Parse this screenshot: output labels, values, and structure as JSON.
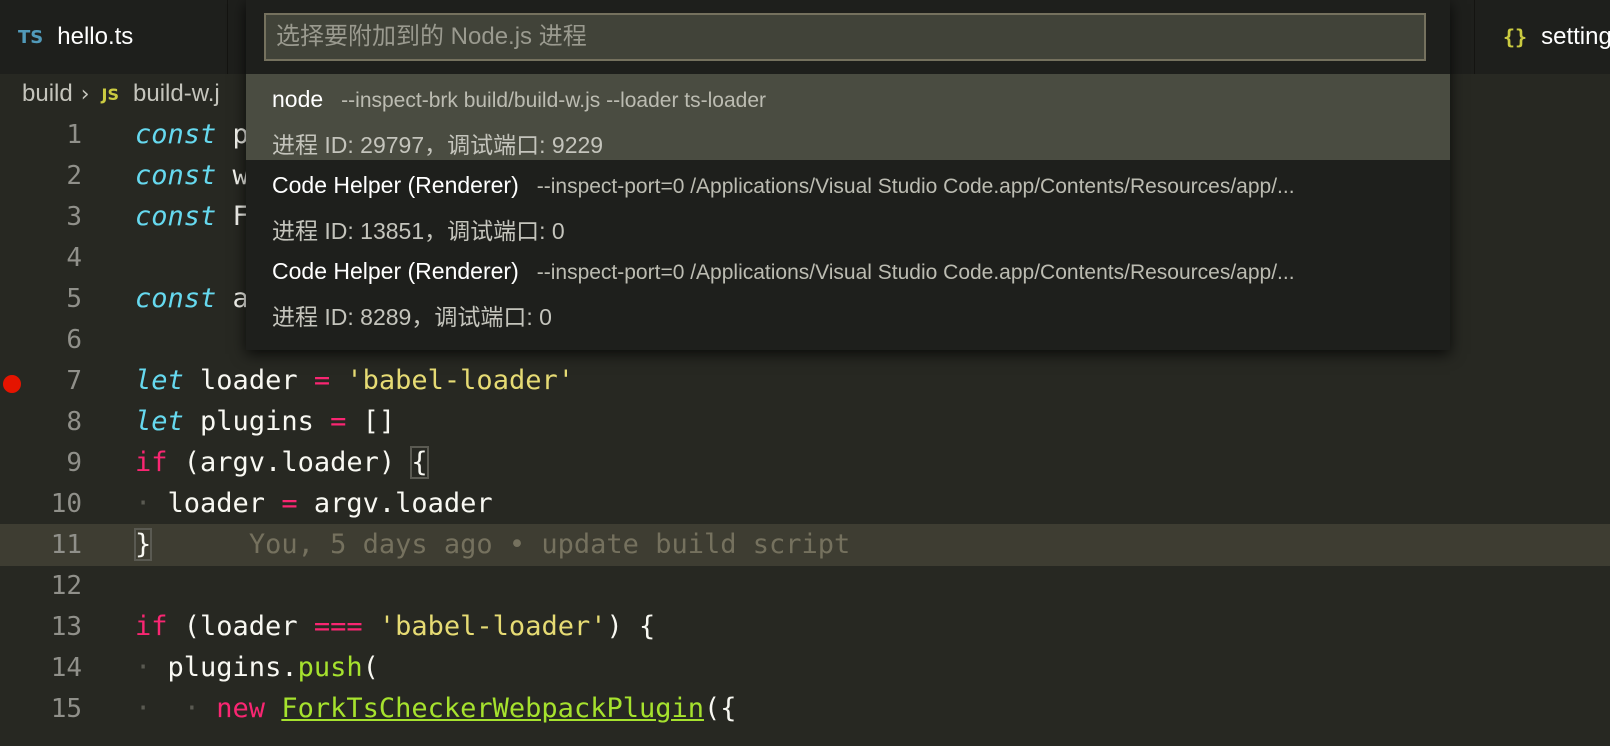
{
  "tabs": [
    {
      "label": "hello.ts",
      "icon": "typescript-file-icon",
      "icon_text": "TS"
    },
    {
      "label": "setting",
      "icon": "json-file-icon",
      "icon_text": "{}"
    }
  ],
  "breadcrumb": {
    "folder": "build",
    "file_icon_text": "JS",
    "file": "build-w.j"
  },
  "quick_pick": {
    "placeholder": "选择要附加到的 Node.js 进程",
    "items": [
      {
        "label": "node",
        "description": "--inspect-brk build/build-w.js --loader ts-loader",
        "detail": "进程 ID: 29797，调试端口: 9229"
      },
      {
        "label": "Code Helper (Renderer)",
        "description": "--inspect-port=0 /Applications/Visual Studio Code.app/Contents/Resources/app/...",
        "detail": "进程 ID: 13851，调试端口: 0"
      },
      {
        "label": "Code Helper (Renderer)",
        "description": "--inspect-port=0 /Applications/Visual Studio Code.app/Contents/Resources/app/...",
        "detail": "进程 ID: 8289，调试端口: 0"
      }
    ]
  },
  "editor": {
    "line_numbers": [
      "1",
      "2",
      "3",
      "4",
      "5",
      "6",
      "7",
      "8",
      "9",
      "10",
      "11",
      "12",
      "13",
      "14",
      "15"
    ],
    "tokens": {
      "l1_kw": "const",
      "l1_id": "p",
      "l2_kw": "const",
      "l2_id": "w",
      "l3_kw": "const",
      "l3_id": "F",
      "l5_kw": "const",
      "l5_id": "a",
      "l7_kw": "let",
      "l7_id": "loader",
      "l7_op": "=",
      "l7_str": "'babel-loader'",
      "l8_kw": "let",
      "l8_id": "plugins",
      "l8_op": "=",
      "l8_rest": "[]",
      "l9_kw": "if",
      "l9_rest": "(argv.loader)",
      "l9_brace": "{",
      "l10_ws": "·",
      "l10_id": "loader",
      "l10_op": "=",
      "l10_rest": "argv.loader",
      "l11_brace": "}",
      "l11_blame": "You, 5 days ago • update build script",
      "l13_kw": "if",
      "l13_open": "(loader",
      "l13_op": "===",
      "l13_str": "'babel-loader'",
      "l13_close": ") {",
      "l14_ws": "·",
      "l14_obj": "plugins.",
      "l14_fn": "push",
      "l14_paren": "(",
      "l15_ws": "·  ·",
      "l15_kw": "new",
      "l15_cls": "ForkTsCheckerWebpackPlugin",
      "l15_rest": "({"
    }
  },
  "colors": {
    "editor_bg": "#272822",
    "keyword_storage": "#66d9ef",
    "keyword": "#f92672",
    "string": "#e6db74",
    "function": "#a6e22e",
    "breakpoint": "#e51400",
    "selected_item_bg": "#4a4c41"
  }
}
